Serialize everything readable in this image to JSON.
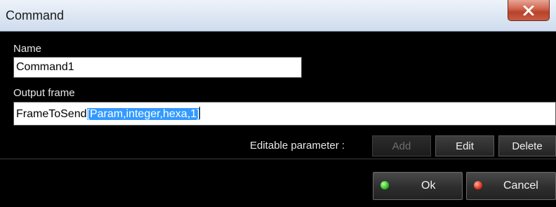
{
  "window": {
    "title": "Command",
    "close_icon": "close-x-icon"
  },
  "name_field": {
    "label": "Name",
    "value": "Command1"
  },
  "output_frame": {
    "label": "Output frame",
    "value_plain": "FrameToSend",
    "value_selected": "[Param,integer,hexa,1]"
  },
  "editable_parameter": {
    "label": "Editable parameter :",
    "add_label": "Add",
    "edit_label": "Edit",
    "delete_label": "Delete"
  },
  "actions": {
    "ok_label": "Ok",
    "cancel_label": "Cancel",
    "ok_color": "#2fbe23",
    "cancel_color": "#e0331f"
  }
}
